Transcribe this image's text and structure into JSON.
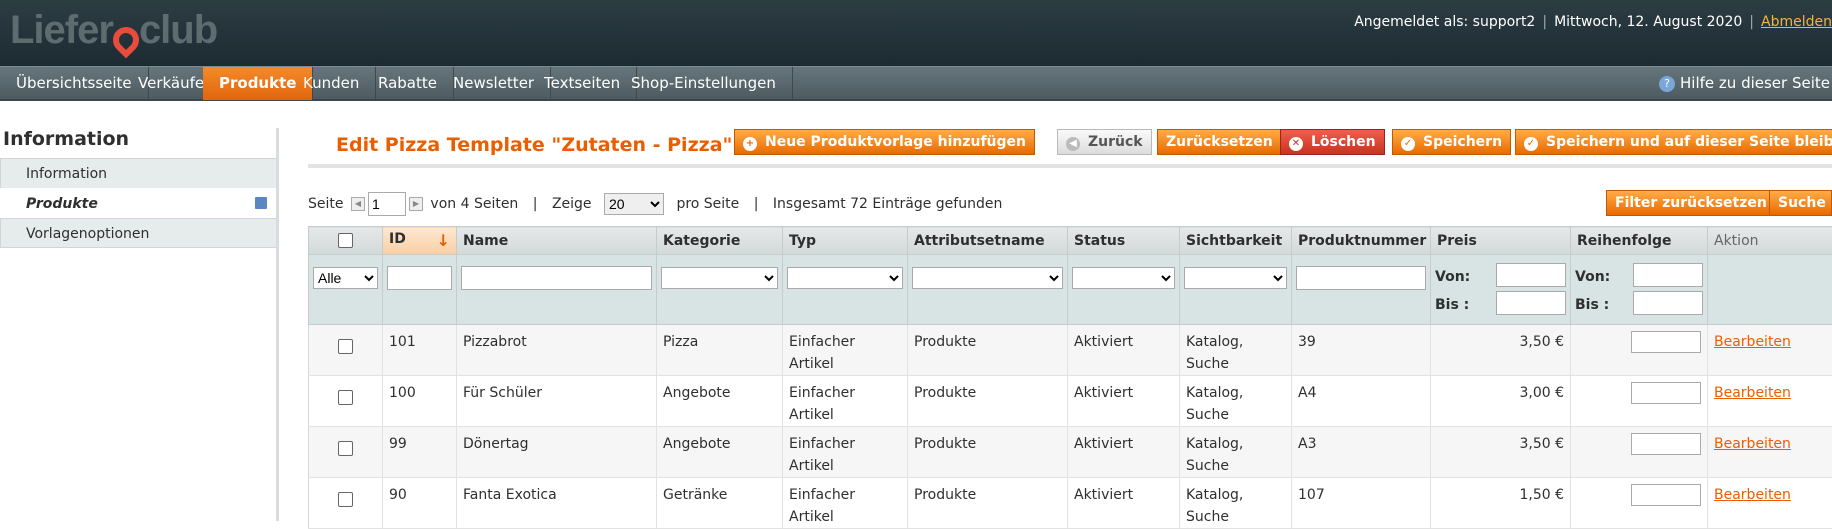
{
  "header": {
    "logo_left": "Liefer",
    "logo_right": "club",
    "logged_in": "Angemeldet als: support2",
    "date": "Mittwoch, 12. August 2020",
    "logout": "Abmelden"
  },
  "nav": {
    "items": [
      "Übersichtsseite",
      "Verkäufe",
      "Produkte",
      "Kunden",
      "Rabatte",
      "Newsletter",
      "Textseiten",
      "Shop-Einstellungen"
    ],
    "active": "Produkte",
    "help": "Hilfe zu dieser Seite"
  },
  "sidebar": {
    "title": "Information",
    "items": [
      "Information",
      "Produkte",
      "Vorlagenoptionen"
    ]
  },
  "page": {
    "title": "Edit Pizza Template \"Zutaten - Pizza\""
  },
  "buttons": {
    "new": "Neue Produktvorlage hinzufügen",
    "back": "Zurück",
    "reset": "Zurücksetzen",
    "delete": "Löschen",
    "save": "Speichern",
    "save_stay": "Speichern und auf dieser Seite bleiben",
    "filter_reset": "Filter zurücksetzen",
    "search": "Suche"
  },
  "pager": {
    "page_label": "Seite",
    "page": "1",
    "of_pages": "von 4 Seiten",
    "show": "Zeige",
    "per_page": "20",
    "per_page_label": "pro Seite",
    "total": "Insgesamt 72 Einträge gefunden"
  },
  "table": {
    "headers": [
      "ID",
      "Name",
      "Kategorie",
      "Typ",
      "Attributsetname",
      "Status",
      "Sichtbarkeit",
      "Produktnummer",
      "Preis",
      "Reihenfolge",
      "Aktion"
    ],
    "filter": {
      "select_all": "Alle",
      "from": "Von:",
      "to": "Bis :"
    },
    "rows": [
      {
        "id": "101",
        "name": "Pizzabrot",
        "category": "Pizza",
        "type": "Einfacher Artikel",
        "attrset": "Produkte",
        "status": "Aktiviert",
        "visibility": "Katalog, Suche",
        "sku": "39",
        "price": "3,50 €",
        "action": "Bearbeiten"
      },
      {
        "id": "100",
        "name": "Für Schüler",
        "category": "Angebote",
        "type": "Einfacher Artikel",
        "attrset": "Produkte",
        "status": "Aktiviert",
        "visibility": "Katalog, Suche",
        "sku": "A4",
        "price": "3,00 €",
        "action": "Bearbeiten"
      },
      {
        "id": "99",
        "name": "Dönertag",
        "category": "Angebote",
        "type": "Einfacher Artikel",
        "attrset": "Produkte",
        "status": "Aktiviert",
        "visibility": "Katalog, Suche",
        "sku": "A3",
        "price": "3,50 €",
        "action": "Bearbeiten"
      },
      {
        "id": "90",
        "name": "Fanta Exotica",
        "category": "Getränke",
        "type": "Einfacher Artikel",
        "attrset": "Produkte",
        "status": "Aktiviert",
        "visibility": "Katalog, Suche",
        "sku": "107",
        "price": "1,50 €",
        "action": "Bearbeiten"
      }
    ]
  }
}
